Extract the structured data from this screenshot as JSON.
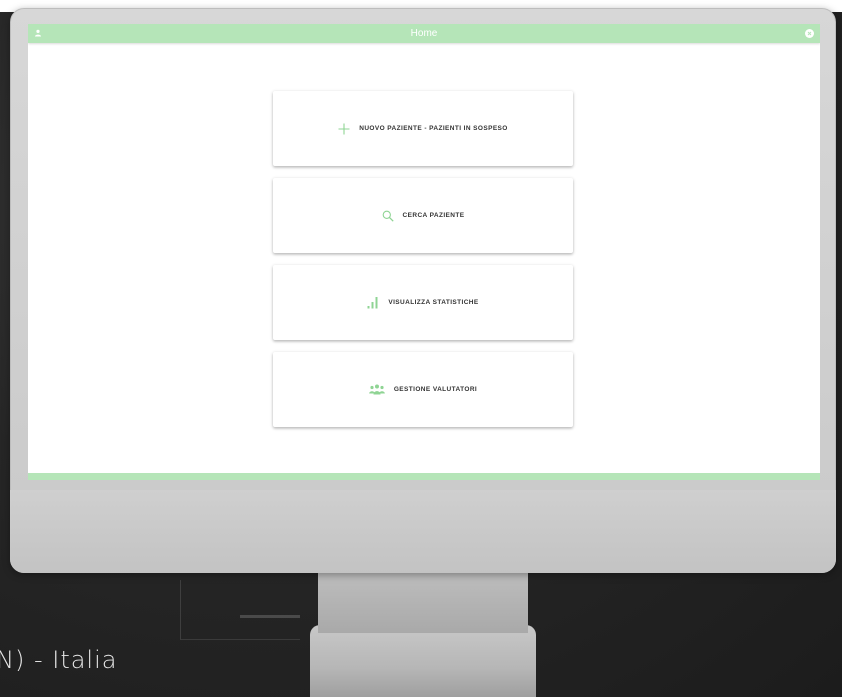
{
  "colors": {
    "accent": "#b5e5b8",
    "icon": "#8fd494",
    "label": "#333333",
    "background": "#262626"
  },
  "window": {
    "title": "Home",
    "left_icon": "user-icon",
    "right_icon": "close-circle-icon"
  },
  "menu": {
    "items": [
      {
        "label": "NUOVO PAZIENTE - PAZIENTI IN SOSPESO",
        "icon": "plus-icon"
      },
      {
        "label": "CERCA PAZIENTE",
        "icon": "search-icon"
      },
      {
        "label": "VISUALIZZA STATISTICHE",
        "icon": "bar-chart-icon"
      },
      {
        "label": "GESTIONE VALUTATORI",
        "icon": "people-icon"
      }
    ]
  },
  "caption": "N) - Italia"
}
